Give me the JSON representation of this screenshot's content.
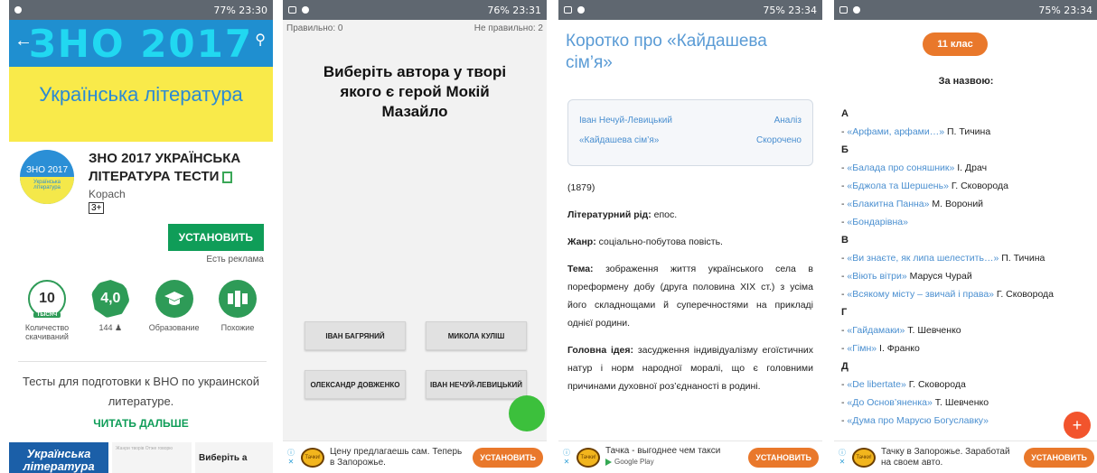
{
  "phone1": {
    "status": {
      "battery": "77%",
      "time": "23:30"
    },
    "banner": {
      "title": "ЗНО 2017",
      "subtitle": "Українська література"
    },
    "app": {
      "logo_line1": "ЗНО 2017",
      "logo_line2": "Українська література",
      "name": "ЗНО 2017 УКРАЇНСЬКА ЛІТЕРАТУРА ТЕСТИ",
      "developer": "Kopach",
      "rating_badge": "3+"
    },
    "install_label": "УСТАНОВИТЬ",
    "ads_note": "Есть реклама",
    "stats": [
      {
        "icon": "downloads-badge-icon",
        "value": "10",
        "tag": "ТЫСЯЧ",
        "label": "Количество скачиваний"
      },
      {
        "icon": "rating-badge-icon",
        "value": "4,0",
        "tag": "★★★★",
        "label": "144 ♟"
      },
      {
        "icon": "education-icon",
        "value": "",
        "tag": "",
        "label": "Образование"
      },
      {
        "icon": "similar-icon",
        "value": "",
        "tag": "",
        "label": "Похожие"
      }
    ],
    "description": "Тесты для подготовки к ВНО по украинской литературе.",
    "read_more": "ЧИТАТЬ ДАЛЬШЕ",
    "screenshots": {
      "shot1": "Українська література",
      "shot2": "Жанри творів  Отже говорю",
      "shot3": "Виберіть а"
    }
  },
  "phone2": {
    "status": {
      "battery": "76%",
      "time": "23:31"
    },
    "correct": "Правильно: 0",
    "incorrect": "Не правильно: 2",
    "question": "Виберіть автора у творі якого є герой Мокій Мазайло",
    "answers": [
      "ІВАН БАГРЯНИЙ",
      "МИКОЛА КУЛІШ",
      "ОЛЕКСАНДР ДОВЖЕНКО",
      "ІВАН НЕЧУЙ-ЛЕВИЦЬКИЙ"
    ],
    "ad": {
      "logo": "Тачки!",
      "text": "Цену предлагаешь сам. Теперь в Запорожье.",
      "button": "УСТАНОВИТЬ"
    }
  },
  "phone3": {
    "status": {
      "battery": "75%",
      "time": "23:34"
    },
    "title": "Коротко про «Кайдашева сім’я»",
    "box": {
      "author": "Іван Нечуй-Левицький",
      "analysis": "Аналіз",
      "work": "«Кайдашева сім’я»",
      "short": "Скорочено"
    },
    "year": "(1879)",
    "genus_label": "Літературний рід:",
    "genus_value": " епос.",
    "genre_label": "Жанр:",
    "genre_value": " соціально-побутова повість.",
    "theme_label": "Тема:",
    "theme_value": " зображення життя українського села в пореформену добу (друга половина XIX ст.) з усіма його складнощами й суперечностями на прикладі однієї родини.",
    "idea_label": "Головна ідея:",
    "idea_value": " засудження індивідуалізму егоїстичних натур і норм народної моралі, що є головними причинами духовної роз’єднаності в родині.",
    "ad": {
      "logo": "Тачки!",
      "text": "Тачка - выгоднее чем такси",
      "store": "Google Play",
      "button": "УСТАНОВИТЬ"
    }
  },
  "phone4": {
    "status": {
      "battery": "75%",
      "time": "23:34"
    },
    "class_label": "11 клас",
    "by_name": "За назвою:",
    "rows": [
      {
        "type": "letter",
        "text": "А"
      },
      {
        "type": "item",
        "title": "«Арфами, арфами…»",
        "author": " П. Тичина"
      },
      {
        "type": "letter",
        "text": "Б"
      },
      {
        "type": "item",
        "title": "«Балада про соняшник»",
        "author": " І. Драч"
      },
      {
        "type": "item",
        "title": "«Бджола та Шершень»",
        "author": " Г. Сковорода"
      },
      {
        "type": "item",
        "title": "«Блакитна Панна»",
        "author": " М. Вороний"
      },
      {
        "type": "item",
        "title": "«Бондарівна»",
        "author": ""
      },
      {
        "type": "letter",
        "text": "В"
      },
      {
        "type": "item",
        "title": "«Ви знаєте, як липа шелестить…»",
        "author": " П. Тичина"
      },
      {
        "type": "item",
        "title": "«Віють вітри»",
        "author": " Маруся Чурай"
      },
      {
        "type": "item",
        "title": "«Всякому місту – звичай і права»",
        "author": " Г. Сковорода"
      },
      {
        "type": "letter",
        "text": "Г"
      },
      {
        "type": "item",
        "title": "«Гайдамаки»",
        "author": " Т. Шевченко"
      },
      {
        "type": "item",
        "title": "«Гімн»",
        "author": " І. Франко"
      },
      {
        "type": "letter",
        "text": "Д"
      },
      {
        "type": "item",
        "title": "«De libertate»",
        "author": " Г. Сковорода"
      },
      {
        "type": "item",
        "title": "«До Основ’яненка»",
        "author": " Т. Шевченко"
      },
      {
        "type": "item",
        "title": "«Дума про Марусю Богуславку»",
        "author": ""
      }
    ],
    "fab": "+",
    "ad": {
      "logo": "Тачки!",
      "text": "Тачку в Запорожье. Заработай на своем авто.",
      "button": "УСТАНОВИТЬ"
    }
  }
}
